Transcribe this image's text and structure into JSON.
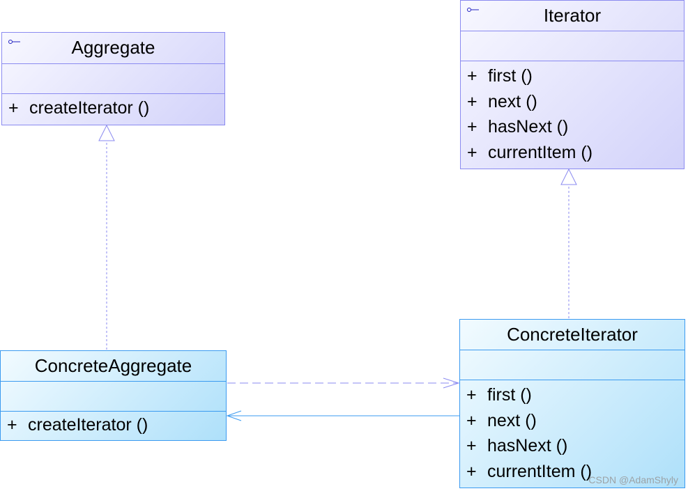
{
  "classes": {
    "aggregate": {
      "name": "Aggregate",
      "stereotype_icon": "interface-icon",
      "operations": [
        "createIterator ()"
      ]
    },
    "iterator": {
      "name": "Iterator",
      "stereotype_icon": "interface-icon",
      "operations": [
        "first ()",
        "next ()",
        "hasNext ()",
        "currentItem ()"
      ]
    },
    "concrete_aggregate": {
      "name": "ConcreteAggregate",
      "operations": [
        "createIterator ()"
      ]
    },
    "concrete_iterator": {
      "name": "ConcreteIterator",
      "operations": [
        "first ()",
        "next ()",
        "hasNext ()",
        "currentItem ()"
      ]
    }
  },
  "visibility": "+",
  "relations": [
    {
      "type": "realization",
      "from": "ConcreteAggregate",
      "to": "Aggregate"
    },
    {
      "type": "realization",
      "from": "ConcreteIterator",
      "to": "Iterator"
    },
    {
      "type": "dependency",
      "from": "ConcreteAggregate",
      "to": "ConcreteIterator"
    },
    {
      "type": "association",
      "from": "ConcreteIterator",
      "to": "ConcreteAggregate"
    }
  ],
  "colors": {
    "interface_border": "#8a8af0",
    "concrete_border": "#3a9af0"
  },
  "watermark": "CSDN @AdamShyly"
}
